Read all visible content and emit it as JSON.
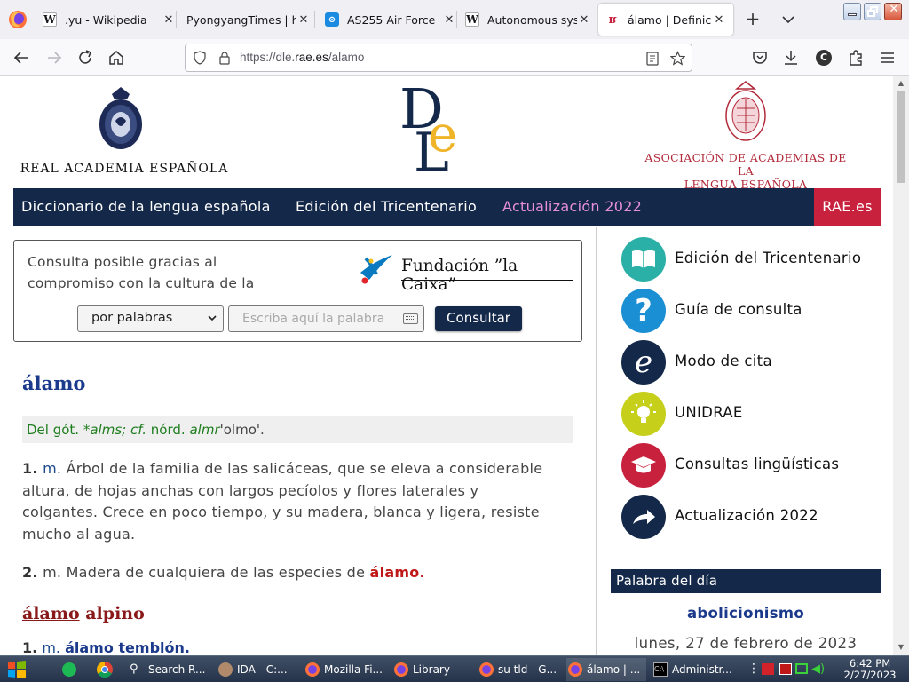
{
  "browser": {
    "tabs": [
      {
        "title": ".yu - Wikipedia",
        "icon": "wikipedia-icon",
        "active": false
      },
      {
        "title": "PyongyangTimes | hom",
        "icon": "blank-icon",
        "active": false
      },
      {
        "title": "AS255 Air Force",
        "icon": "location-pin-icon",
        "active": false
      },
      {
        "title": "Autonomous syste",
        "icon": "wikipedia-icon",
        "active": false
      },
      {
        "title": "álamo | Definición",
        "icon": "rae-icon",
        "active": true
      }
    ],
    "url_prefix": "https://dle.",
    "url_host": "rae.es",
    "url_path": "/alamo"
  },
  "header": {
    "rae_name": "REAL ACADEMIA ESPAÑOLA",
    "asale_line1": "ASOCIACIÓN DE ACADEMIAS DE LA",
    "asale_line2": "LENGUA ESPAÑOLA"
  },
  "mainnav": {
    "item1": "Diccionario de la lengua española",
    "item2": "Edición del Tricentenario",
    "item3": "Actualización 2022",
    "rae_link": "RAE.es"
  },
  "search": {
    "sponsor_line1": "Consulta posible gracias al",
    "sponsor_line2": "compromiso con la cultura de la",
    "sponsor_name": "Fundación ”la Caixa”",
    "mode": "por palabras",
    "placeholder": "Escriba aquí la palabra",
    "button": "Consultar"
  },
  "entry": {
    "word": "álamo",
    "etym_prefix": "Del gót.",
    "etym_goth": "*alms;",
    "etym_cf": "cf.",
    "etym_nord": "nórd.",
    "etym_almr": "almr",
    "etym_gloss": "'olmo'.",
    "def1_num": "1.",
    "def1_abbr": "m.",
    "def1_line1": "Árbol de la familia de las salicáceas, que se eleva a considerable",
    "def1_line2": "altura, de hojas anchas con largos pecíolos y flores laterales y",
    "def1_line3": "colgantes. Crece en poco tiempo, y su madera, blanca y ligera, resiste",
    "def1_line4": "mucho al agua.",
    "def2_num": "2.",
    "def2_abbr": "m.",
    "def2_text": "Madera de cualquiera de las especies de",
    "def2_ref": "álamo.",
    "sub_entry_head": "álamo",
    "sub_entry_tail": "alpino",
    "sub_def_num": "1.",
    "sub_def_abbr": "m.",
    "sub_def_link": "álamo temblón."
  },
  "sidebar": {
    "items": [
      {
        "label": "Edición del Tricentenario",
        "icon": "book-icon",
        "color": "#2ab0a6"
      },
      {
        "label": "Guía de consulta",
        "icon": "question-icon",
        "color": "#1b8fd4"
      },
      {
        "label": "Modo de cita",
        "icon": "citation-e-icon",
        "color": "#142849"
      },
      {
        "label": "UNIDRAE",
        "icon": "lightbulb-icon",
        "color": "#c6cf1a"
      },
      {
        "label": "Consultas lingüísticas",
        "icon": "graduation-cap-icon",
        "color": "#c8213e"
      },
      {
        "label": "Actualización 2022",
        "icon": "forward-arrow-icon",
        "color": "#142849"
      }
    ],
    "word_of_day_header": "Palabra del día",
    "word_of_day": "abolicionismo",
    "word_of_day_date": "lunes, 27 de febrero de 2023"
  },
  "taskbar": {
    "buttons": [
      {
        "label": "Search R...",
        "icon": "search-icon"
      },
      {
        "label": "IDA - C:...",
        "icon": "ida-icon"
      },
      {
        "label": "Mozilla Fi...",
        "icon": "firefox-icon"
      },
      {
        "label": "Library",
        "icon": "firefox-icon"
      },
      {
        "label": "su tld - G...",
        "icon": "firefox-icon"
      },
      {
        "label": "álamo | ...",
        "icon": "firefox-icon"
      },
      {
        "label": "Administr...",
        "icon": "cmd-icon"
      }
    ],
    "time": "6:42 PM",
    "date": "2/27/2023"
  },
  "colors": {
    "navy": "#142849",
    "rae_red": "#c8213e",
    "link_blue": "#1b3a8c",
    "etym_green": "#1e7d1e",
    "pink": "#e88fdc"
  }
}
